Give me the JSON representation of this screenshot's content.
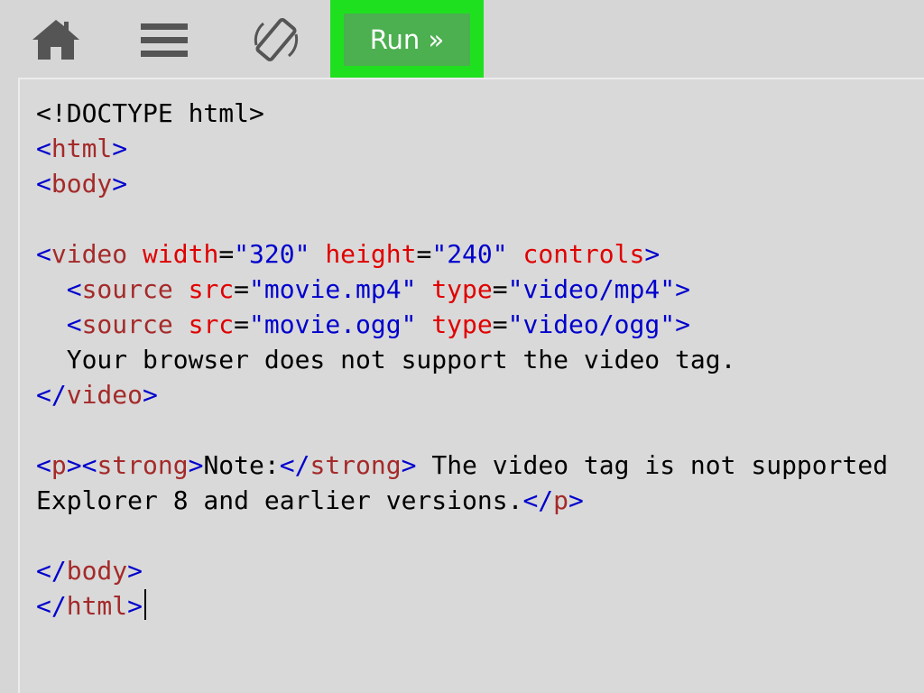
{
  "toolbar": {
    "icons": [
      "home-icon",
      "menu-icon",
      "rotate-screen-icon"
    ],
    "run_label": "Run »",
    "run_highlight_color": "#1fe01f",
    "run_button_color": "#4caf50"
  },
  "colors": {
    "bracket": "#0000cd",
    "tag": "#a52a2a",
    "attr": "#e00000",
    "value": "#0000cd",
    "text": "#000000",
    "editor_bg": "#d9d9d9"
  },
  "editor": {
    "lines": [
      [
        [
          "text",
          "<!DOCTYPE html>"
        ]
      ],
      [
        [
          "bracket",
          "<"
        ],
        [
          "tag",
          "html"
        ],
        [
          "bracket",
          ">"
        ]
      ],
      [
        [
          "bracket",
          "<"
        ],
        [
          "tag",
          "body"
        ],
        [
          "bracket",
          ">"
        ]
      ],
      [],
      [
        [
          "bracket",
          "<"
        ],
        [
          "tag",
          "video"
        ],
        [
          "text",
          " "
        ],
        [
          "attr",
          "width"
        ],
        [
          "text",
          "="
        ],
        [
          "value",
          "\"320\""
        ],
        [
          "text",
          " "
        ],
        [
          "attr",
          "height"
        ],
        [
          "text",
          "="
        ],
        [
          "value",
          "\"240\""
        ],
        [
          "text",
          " "
        ],
        [
          "attr",
          "controls"
        ],
        [
          "bracket",
          ">"
        ]
      ],
      [
        [
          "text",
          "  "
        ],
        [
          "bracket",
          "<"
        ],
        [
          "tag",
          "source"
        ],
        [
          "text",
          " "
        ],
        [
          "attr",
          "src"
        ],
        [
          "text",
          "="
        ],
        [
          "value",
          "\"movie.mp4\""
        ],
        [
          "text",
          " "
        ],
        [
          "attr",
          "type"
        ],
        [
          "text",
          "="
        ],
        [
          "value",
          "\"video/mp4\""
        ],
        [
          "bracket",
          ">"
        ]
      ],
      [
        [
          "text",
          "  "
        ],
        [
          "bracket",
          "<"
        ],
        [
          "tag",
          "source"
        ],
        [
          "text",
          " "
        ],
        [
          "attr",
          "src"
        ],
        [
          "text",
          "="
        ],
        [
          "value",
          "\"movie.ogg\""
        ],
        [
          "text",
          " "
        ],
        [
          "attr",
          "type"
        ],
        [
          "text",
          "="
        ],
        [
          "value",
          "\"video/ogg\""
        ],
        [
          "bracket",
          ">"
        ]
      ],
      [
        [
          "text",
          "  Your browser does not support the video tag."
        ]
      ],
      [
        [
          "bracket",
          "</"
        ],
        [
          "tag",
          "video"
        ],
        [
          "bracket",
          ">"
        ]
      ],
      [],
      [
        [
          "bracket",
          "<"
        ],
        [
          "tag",
          "p"
        ],
        [
          "bracket",
          "><"
        ],
        [
          "tag",
          "strong"
        ],
        [
          "bracket",
          ">"
        ],
        [
          "text",
          "Note:"
        ],
        [
          "bracket",
          "</"
        ],
        [
          "tag",
          "strong"
        ],
        [
          "bracket",
          ">"
        ],
        [
          "text",
          " The video tag is not supported"
        ]
      ],
      [
        [
          "text",
          "Explorer 8 and earlier versions."
        ],
        [
          "bracket",
          "</"
        ],
        [
          "tag",
          "p"
        ],
        [
          "bracket",
          ">"
        ]
      ],
      [],
      [
        [
          "bracket",
          "</"
        ],
        [
          "tag",
          "body"
        ],
        [
          "bracket",
          ">"
        ]
      ],
      [
        [
          "bracket",
          "</"
        ],
        [
          "tag",
          "html"
        ],
        [
          "bracket",
          ">"
        ]
      ]
    ]
  }
}
